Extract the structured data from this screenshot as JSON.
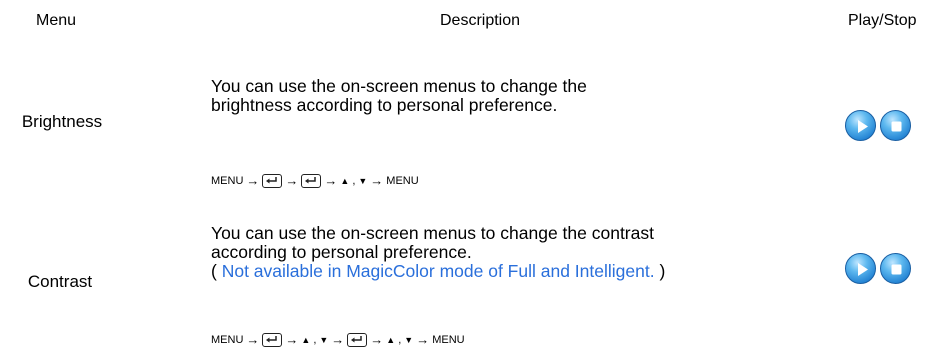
{
  "header": {
    "menu": "Menu",
    "description": "Description",
    "play_stop": "Play/Stop"
  },
  "rows": [
    {
      "menu": "Brightness",
      "description_line1": "You can use the on-screen menus to change the",
      "description_line2": "brightness according to personal preference.",
      "sequence_start": "MENU",
      "sequence_end": "MENU",
      "sequence": [
        "MENU",
        "enter-key",
        "enter-key",
        "up-down-keys",
        "MENU"
      ]
    },
    {
      "menu": "Contrast",
      "description_line1": "You can use the on-screen menus to change the contrast",
      "description_line2": "according to personal preference.",
      "note_open": "( ",
      "note": "Not available in MagicColor mode of Full and Intelligent.",
      "note_close": " )",
      "sequence_start": "MENU",
      "sequence_end": "MENU",
      "sequence": [
        "MENU",
        "enter-key",
        "up-down-keys",
        "enter-key",
        "up-down-keys",
        "MENU"
      ]
    }
  ],
  "separators": {
    "arrow": "→",
    "comma": ",",
    "up": "▲",
    "down": "▼"
  },
  "icons": {
    "play": "play-icon",
    "stop": "stop-icon",
    "enter": "enter-key-icon"
  },
  "colors": {
    "note": "#2a6fdb",
    "button_blue": "#1f7fd1"
  }
}
